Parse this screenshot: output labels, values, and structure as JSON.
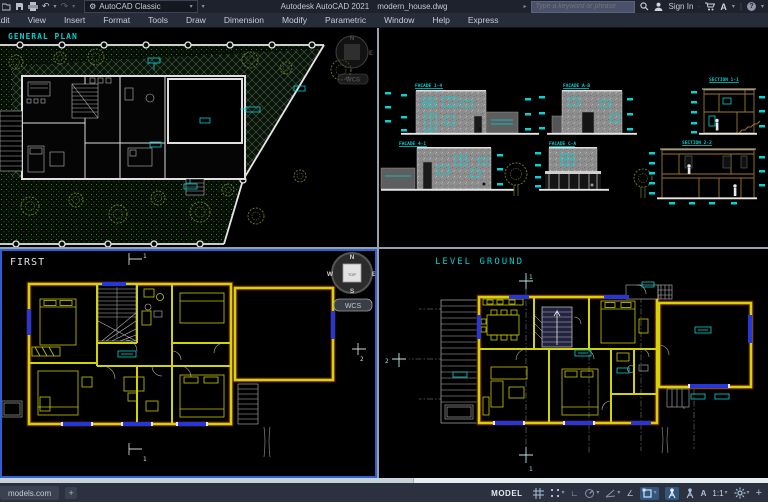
{
  "colors": {
    "cad_cyan": "#00d0d0",
    "wall_yellow": "#d4d400",
    "window_blue": "#2438d8",
    "active_viewport_border": "#2e5fd3",
    "site_green": "#2f8a2f",
    "titlebar_bg": "#1d222c",
    "statusbar_bg": "#2b313f"
  },
  "titlebar": {
    "workspace": "AutoCAD Classic",
    "app_title": "Autodesk AutoCAD 2021",
    "filename": "modern_house.dwg",
    "search_placeholder": "Type a keyword or phrase",
    "sign_in_label": "Sign In"
  },
  "menubar": {
    "items": [
      {
        "label": "Edit"
      },
      {
        "label": "View"
      },
      {
        "label": "Insert"
      },
      {
        "label": "Format"
      },
      {
        "label": "Tools"
      },
      {
        "label": "Draw"
      },
      {
        "label": "Dimension"
      },
      {
        "label": "Modify"
      },
      {
        "label": "Parametric"
      },
      {
        "label": "Window"
      },
      {
        "label": "Help"
      },
      {
        "label": "Express"
      }
    ]
  },
  "viewports": {
    "general_plan": {
      "label": "GENERAL PLAN",
      "viewcube": {
        "north": "N",
        "east": "E"
      },
      "wcs_label": "WCS"
    },
    "elevations": {
      "facade_1_4": "FACADE 1-4",
      "facade_a_b": "FACADE A-B",
      "section_1_1": "SECTION 1-1",
      "facade_4_1": "FACADE 4-1",
      "facade_c_a": "FACADE C-A",
      "section_2_2": "SECTION 2-2"
    },
    "first": {
      "label": "FIRST",
      "marker_top": "1",
      "marker_bottom": "1",
      "marker_right": "2",
      "viewcube": {
        "north": "N",
        "west": "W",
        "east": "E",
        "south": "S",
        "top_face": "TOP"
      },
      "wcs_label": "WCS"
    },
    "level_ground": {
      "label": "LEVEL GROUND",
      "marker_top": "1",
      "marker_bottom": "1",
      "marker_left": "2"
    }
  },
  "statusbar": {
    "layout_tab": "models.com",
    "add_tab": "+",
    "model_toggle": "MODEL",
    "scale": "1:1"
  }
}
